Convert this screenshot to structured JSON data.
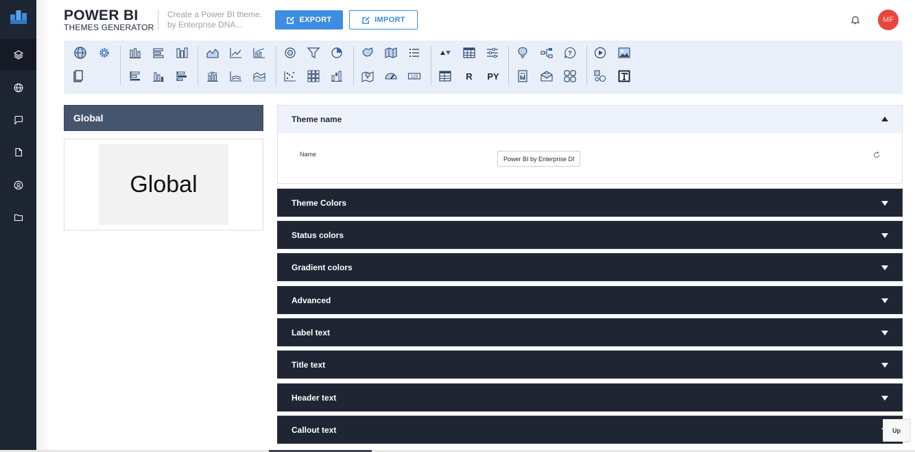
{
  "brand": {
    "title": "POWER BI",
    "subtitle": "THEMES GENERATOR",
    "tagline_line1": "Create a Power BI theme.",
    "tagline_line2": "by Enterprise DNA..."
  },
  "header": {
    "export_label": "EXPORT",
    "import_label": "IMPORT",
    "avatar_initials": "MF",
    "accent_color": "#3d8de0",
    "avatar_color": "#e8453c"
  },
  "rail": {
    "items": [
      "layers-icon",
      "globe-icon",
      "chat-icon",
      "document-icon",
      "user-circle-icon",
      "folder-icon"
    ],
    "active": "layers-icon"
  },
  "toolbar": {
    "text_icons": {
      "r": "R",
      "py": "PY"
    }
  },
  "left_panel": {
    "heading": "Global",
    "preview_text": "Global"
  },
  "theme_name_section": {
    "title": "Theme name",
    "field_label": "Name",
    "field_value": "Power BI by Enterprise DN"
  },
  "sections": [
    "Theme Colors",
    "Status colors",
    "Gradient colors",
    "Advanced",
    "Label text",
    "Title text",
    "Header text",
    "Callout text"
  ],
  "up_button": "Up"
}
